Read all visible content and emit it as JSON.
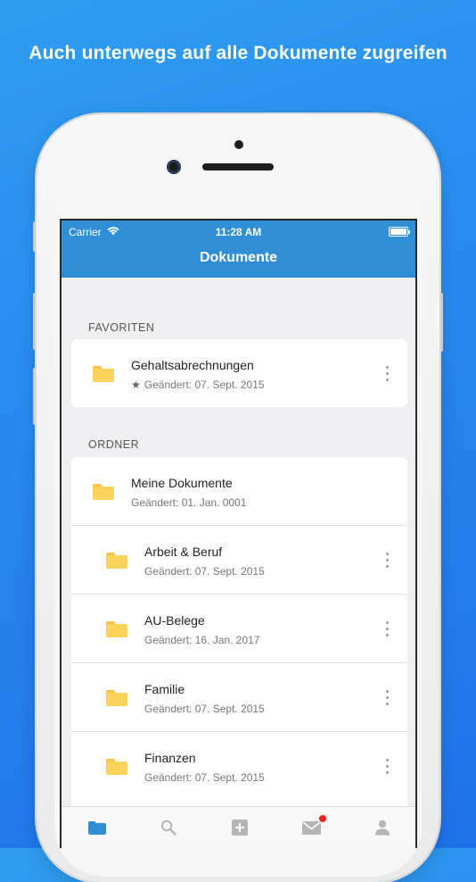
{
  "headline": "Auch unterwegs auf alle Dokumente zugreifen",
  "status_bar": {
    "carrier": "Carrier",
    "time": "11:28 AM"
  },
  "nav": {
    "title": "Dokumente"
  },
  "favorites": {
    "header": "FAVORITEN",
    "items": [
      {
        "name": "Gehaltsabrechnungen",
        "modified": "Geändert: 07. Sept. 2015",
        "starred": true
      }
    ]
  },
  "folders": {
    "header": "ORDNER",
    "root": {
      "name": "Meine Dokumente",
      "modified": "Geändert: 01. Jan. 0001"
    },
    "items": [
      {
        "name": "Arbeit & Beruf",
        "modified": "Geändert: 07. Sept. 2015"
      },
      {
        "name": "AU-Belege",
        "modified": "Geändert: 16. Jan. 2017"
      },
      {
        "name": "Familie",
        "modified": "Geändert: 07. Sept. 2015"
      },
      {
        "name": "Finanzen",
        "modified": "Geändert: 07. Sept. 2015"
      }
    ]
  },
  "tabbar": {
    "items": [
      {
        "icon": "folder-icon",
        "active": true
      },
      {
        "icon": "search-icon",
        "active": false
      },
      {
        "icon": "add-icon",
        "active": false
      },
      {
        "icon": "mail-icon",
        "active": false,
        "badge": true
      },
      {
        "icon": "user-icon",
        "active": false
      }
    ]
  },
  "colors": {
    "accent": "#2f8ed4",
    "folder": "#fbd35a",
    "badge": "#ff2020"
  }
}
